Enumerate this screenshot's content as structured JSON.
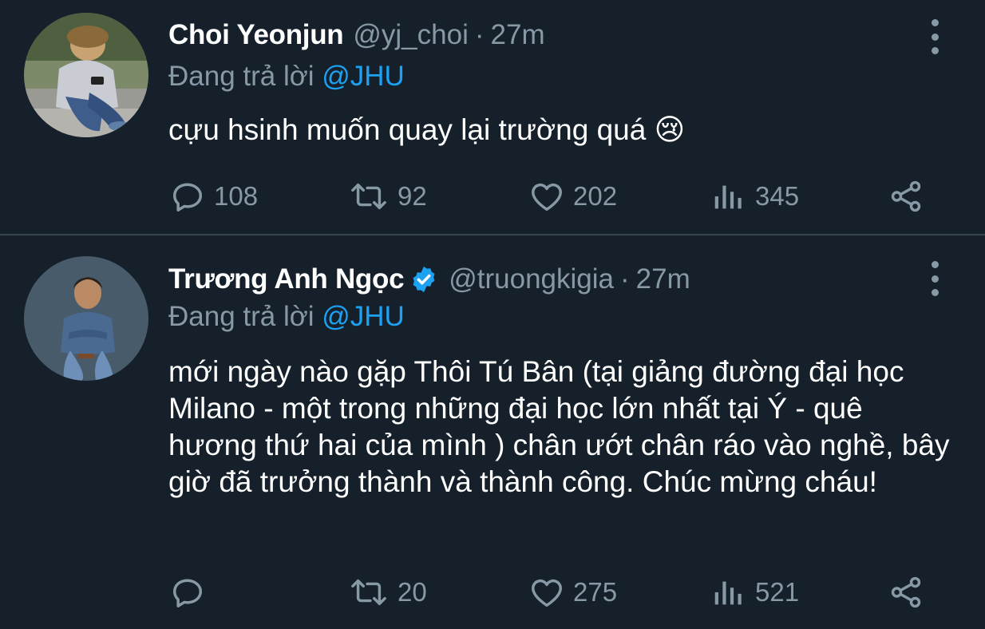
{
  "tweets": [
    {
      "display_name": "Choi Yeonjun",
      "handle": "@yj_choi",
      "separator": "·",
      "time": "27m",
      "verified": false,
      "replying_prefix": "Đang trả lời",
      "replying_to": "@JHU",
      "text": "cựu hsinh muốn quay lại trường quá 😢",
      "replies": "108",
      "retweets": "92",
      "likes": "202",
      "views": "345"
    },
    {
      "display_name": "Trương Anh Ngọc",
      "handle": "@truongkigia",
      "separator": "·",
      "time": "27m",
      "verified": true,
      "replying_prefix": "Đang trả lời",
      "replying_to": "@JHU",
      "text": "mới ngày nào gặp Thôi Tú Bân (tại giảng đường đại học Milano - một trong những đại học lớn nhất tại Ý - quê hương thứ hai của mình ) chân ướt chân ráo vào nghề, bây giờ đã trưởng thành và thành công. Chúc mừng cháu!",
      "replies": "",
      "retweets": "20",
      "likes": "275",
      "views": "521"
    }
  ],
  "icons": {
    "reply": "reply-icon",
    "retweet": "retweet-icon",
    "like": "heart-icon",
    "views": "views-icon",
    "share": "share-icon",
    "more": "more-vertical-icon",
    "verified": "verified-badge-icon"
  },
  "colors": {
    "background": "#15202b",
    "secondary_text": "#8899a6",
    "link": "#1da1f2",
    "divider": "#38444d"
  }
}
